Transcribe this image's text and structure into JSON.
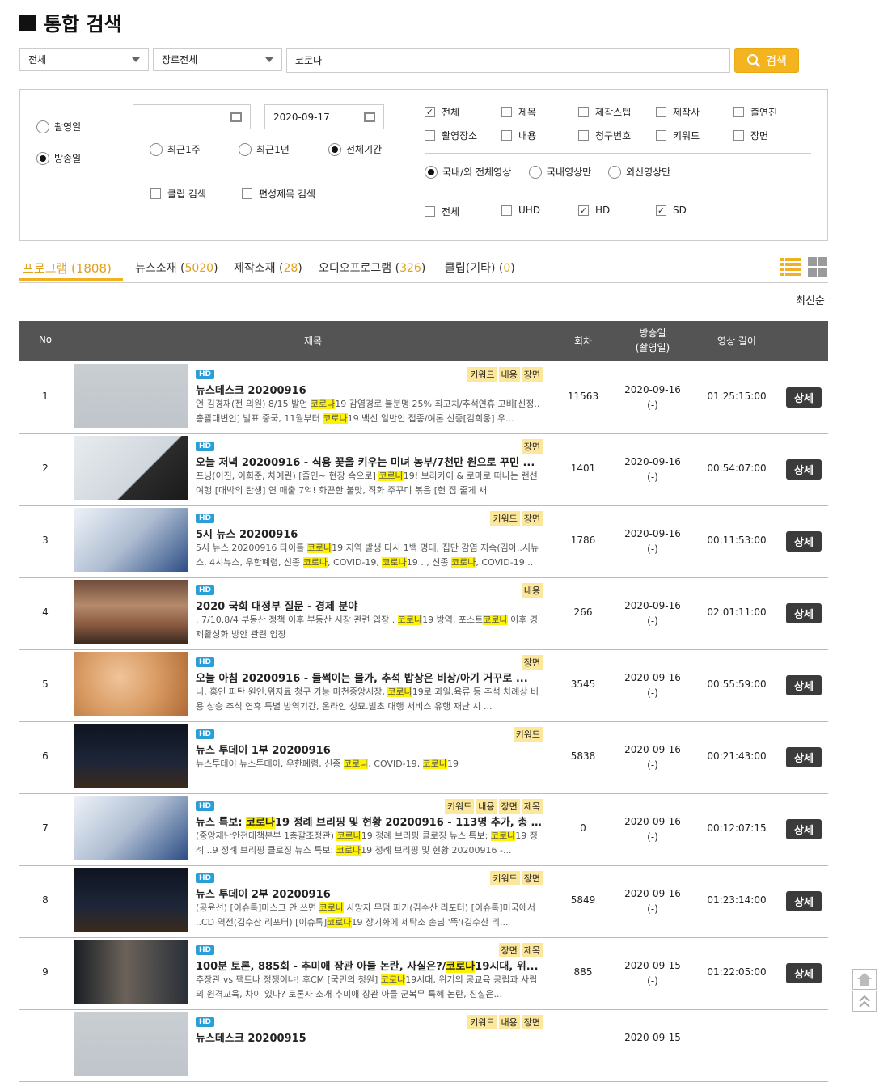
{
  "page": {
    "title": "통합 검색"
  },
  "search": {
    "category": "전체",
    "genre": "장르전체",
    "query": "코로나",
    "button": "검색"
  },
  "filters": {
    "date_type": {
      "options": [
        "촬영일",
        "방송일"
      ],
      "selected": "방송일"
    },
    "date_from": "",
    "date_to": "2020-09-17",
    "date_sep": "-",
    "period": {
      "options": [
        "최근1주",
        "최근1년",
        "전체기간"
      ],
      "selected": "전체기간"
    },
    "clip_search": "클립 검색",
    "program_title_search": "편성제목 검색",
    "fields": [
      {
        "label": "전체",
        "checked": true
      },
      {
        "label": "제목",
        "checked": false
      },
      {
        "label": "제작스텝",
        "checked": false
      },
      {
        "label": "제작사",
        "checked": false
      },
      {
        "label": "출연진",
        "checked": false
      },
      {
        "label": "촬영장소",
        "checked": false
      },
      {
        "label": "내용",
        "checked": false
      },
      {
        "label": "청구번호",
        "checked": false
      },
      {
        "label": "키워드",
        "checked": false
      },
      {
        "label": "장면",
        "checked": false
      }
    ],
    "origin": {
      "options": [
        "국내/외 전체영상",
        "국내영상만",
        "외신영상만"
      ],
      "selected": "국내/외 전체영상"
    },
    "quality": [
      {
        "label": "전체",
        "checked": false
      },
      {
        "label": "UHD",
        "checked": false
      },
      {
        "label": "HD",
        "checked": true
      },
      {
        "label": "SD",
        "checked": true
      }
    ]
  },
  "tabs": [
    {
      "label": "프로그램",
      "count": "1808",
      "active": true
    },
    {
      "label": "뉴스소재",
      "count": "5020"
    },
    {
      "label": "제작소재",
      "count": "28"
    },
    {
      "label": "오디오프로그램",
      "count": "326"
    },
    {
      "label": "클립(기타)",
      "count": "0"
    }
  ],
  "sort": "최신순",
  "table": {
    "headers": {
      "no": "No",
      "title": "제목",
      "episode": "회차",
      "date_l1": "방송일",
      "date_l2": "(촬영일)",
      "duration": "영상 길이"
    },
    "detail_label": "상세",
    "badge": "HD",
    "rows": [
      {
        "no": "1",
        "tags": [
          "키워드",
          "내용",
          "장면"
        ],
        "title": "뉴스데스크 20200916",
        "desc": "언 김경재(전 의원) 8/15 발언 [[코로나]]19 감염경로 불분명 25% 최고치/추석연휴 고비[신정..총괄대변인] 발표 중국, 11월부터 [[코로나]]19 백신 일반인 접종/여론 신중[김희웅] 우...",
        "ep": "11563",
        "date": "2020-09-16",
        "sub": "(-)",
        "dur": "01:25:15:00"
      },
      {
        "no": "2",
        "tags": [
          "장면"
        ],
        "title": "오늘 저녁 20200916 - 식용 꽃을 키우는 미녀 농부/7천만 원으로 꾸민 ...",
        "desc": "프닝(이진, 이희준, 차예린) [줄인~ 현장 속으로] [[코로나]]19! 보라카이 & 로마로 떠나는 랜선 여행 [대박의 탄생] 연 매출 7억! 화끈한 불맛, 직화 주꾸미 볶음 [헌 집 줄게 새",
        "ep": "1401",
        "date": "2020-09-16",
        "sub": "(-)",
        "dur": "00:54:07:00"
      },
      {
        "no": "3",
        "tags": [
          "키워드",
          "장면"
        ],
        "title": "5시 뉴스 20200916",
        "desc": "5시 뉴스 20200916 타이틀 [[코로나]]19 지역 발생 다시 1백 명대, 집단 감염 지속(김아..시뉴스, 4시뉴스, 우한폐렴, 신종 [[코로나]], COVID-19, [[코로나]]19 .., 신종 [[코로나]], COVID-19...",
        "ep": "1786",
        "date": "2020-09-16",
        "sub": "(-)",
        "dur": "00:11:53:00"
      },
      {
        "no": "4",
        "tags": [
          "내용"
        ],
        "title": "2020 국회 대정부 질문 - 경제 분야",
        "desc": ". 7/10.8/4 부동산 정책 이후 부동산 시장 관련 입장 . [[코로나]]19 방역, 포스트[[코로나]] 이후 경제활성화 방안 관련 입장",
        "ep": "266",
        "date": "2020-09-16",
        "sub": "(-)",
        "dur": "02:01:11:00"
      },
      {
        "no": "5",
        "tags": [
          "장면"
        ],
        "title": "오늘 아침 20200916 - 들썩이는 물가, 추석 밥상은 비상/아기 거꾸로 ...",
        "desc": "니, 홍인 파탄 원인.위자료 청구 가능 마천중앙시장, [[코로나]]19로 과일.육류 등 추석 차례상 비용 상승 추석 연휴 특별 방역기간, 온라인 성묘.벌초 대행 서비스 유행 재난 시 ...",
        "ep": "3545",
        "date": "2020-09-16",
        "sub": "(-)",
        "dur": "00:55:59:00"
      },
      {
        "no": "6",
        "tags": [
          "키워드"
        ],
        "title": "뉴스 투데이 1부 20200916",
        "desc": "뉴스투데이 뉴스투데이, 우한폐렴, 신종 [[코로나]], COVID-19, [[코로나]]19",
        "ep": "5838",
        "date": "2020-09-16",
        "sub": "(-)",
        "dur": "00:21:43:00"
      },
      {
        "no": "7",
        "tags": [
          "키워드",
          "내용",
          "장면",
          "제목"
        ],
        "title": "뉴스 특보: [[코로나]]19 정례 브리핑 및 현황 20200916 - 113명 추가, 총 ...",
        "desc": "(중앙재난안전대책본부 1총괄조정관) [[코로나]]19 정례 브리핑 클로징 뉴스 특보: [[코로나]]19 정례 ..9 정례 브리핑 클로징 뉴스 특보: [[코로나]]19 정례 브리핑 및 현황 20200916 -...",
        "ep": "0",
        "date": "2020-09-16",
        "sub": "(-)",
        "dur": "00:12:07:15"
      },
      {
        "no": "8",
        "tags": [
          "키워드",
          "장면"
        ],
        "title": "뉴스 투데이 2부 20200916",
        "desc": "(공윤선) [이슈톡]마스크 안 쓰면 [[코로나]] 사망자 무덤 파기(김수산 리포터) [이슈톡]미국에서 ..CD 역전(김수산 리포터) [이슈톡][[코로나]]19 장기화에 세탁소 손님 '뚝'(김수산 리...",
        "ep": "5849",
        "date": "2020-09-16",
        "sub": "(-)",
        "dur": "01:23:14:00"
      },
      {
        "no": "9",
        "tags": [
          "장면",
          "제목"
        ],
        "title": "100분 토론, 885회 - 추미애 장관 아들 논란, 사실은?/[[코로나]]19시대, 위...",
        "desc": "추장관 vs 팩트나 정쟁이냐! 후CM [국민의 청원] [[코로나]]19시대, 위기의 공교육 공립과 사립의 원격교육, 차이 있나? 토론자 소개 추미애 장관 아들 군복무 특혜 논란, 진실은...",
        "ep": "885",
        "date": "2020-09-15",
        "sub": "(-)",
        "dur": "01:22:05:00"
      },
      {
        "no": "",
        "tags": [
          "키워드",
          "내용",
          "장면"
        ],
        "title": "뉴스데스크 20200915",
        "desc": "",
        "ep": "",
        "date": "2020-09-15",
        "sub": "",
        "dur": ""
      }
    ]
  },
  "colors": {
    "accent": "#f4b41f",
    "header_bg": "#545454",
    "highlight": "#fff200",
    "tag_bg": "#fde79a",
    "hd_badge": "#2a9fd6"
  },
  "icons": {
    "search": "search-icon",
    "calendar": "calendar-icon",
    "list_view": "list-view-icon",
    "grid_view": "grid-view-icon",
    "home": "home-icon",
    "top": "scroll-top-icon"
  }
}
